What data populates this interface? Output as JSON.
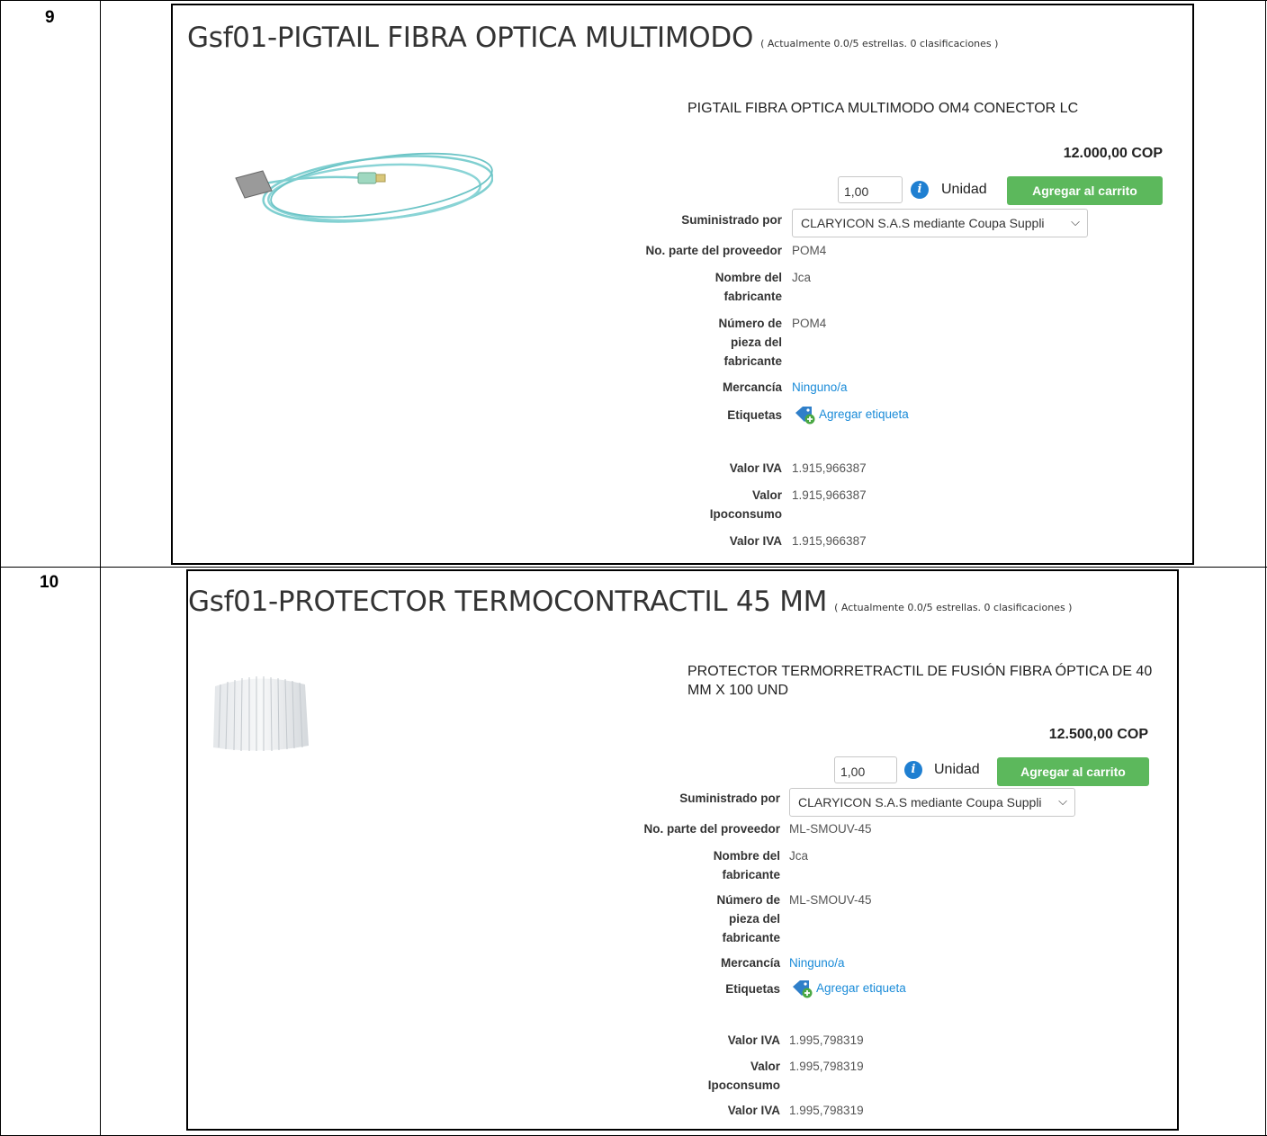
{
  "rows": [
    {
      "number": "9",
      "product": {
        "title": "Gsf01-PIGTAIL FIBRA OPTICA MULTIMODO",
        "rating": "( Actualmente 0.0/5 estrellas. 0 clasificaciones )",
        "description": "PIGTAIL FIBRA OPTICA MULTIMODO OM4 CONECTOR LC",
        "price": "12.000,00 COP",
        "quantity": "1,00",
        "unit": "Unidad",
        "cart_button": "Agregar al carrito",
        "supplier_label": "Suministrado por",
        "supplier_value": "CLARYICON S.A.S mediante Coupa Suppli",
        "supplier_part_label": "No. parte del proveedor",
        "supplier_part_value": "POM4",
        "manufacturer_label": "Nombre del fabricante",
        "manufacturer_value": "Jca",
        "manufacturer_part_label": "Número de pieza del fabricante",
        "manufacturer_part_value": "POM4",
        "commodity_label": "Mercancía",
        "commodity_value": "Ninguno/a",
        "tags_label": "Etiquetas",
        "tags_link": "Agregar etiqueta",
        "iva_label": "Valor IVA",
        "iva_value": "1.915,966387",
        "ipoconsumo_label": "Valor Ipoconsumo",
        "ipoconsumo_value": "1.915,966387",
        "iva2_label": "Valor IVA",
        "iva2_value": "1.915,966387"
      }
    },
    {
      "number": "10",
      "product": {
        "title": "Gsf01-PROTECTOR TERMOCONTRACTIL 45 MM",
        "rating": "( Actualmente 0.0/5 estrellas. 0 clasificaciones )",
        "description": "PROTECTOR TERMORRETRACTIL DE FUSIÓN FIBRA ÓPTICA DE 40 MM X 100 UND",
        "price": "12.500,00 COP",
        "quantity": "1,00",
        "unit": "Unidad",
        "cart_button": "Agregar al carrito",
        "supplier_label": "Suministrado por",
        "supplier_value": "CLARYICON S.A.S mediante Coupa Suppli",
        "supplier_part_label": "No. parte del proveedor",
        "supplier_part_value": "ML-SMOUV-45",
        "manufacturer_label": "Nombre del fabricante",
        "manufacturer_value": "Jca",
        "manufacturer_part_label": "Número de pieza del fabricante",
        "manufacturer_part_value": "ML-SMOUV-45",
        "commodity_label": "Mercancía",
        "commodity_value": "Ninguno/a",
        "tags_label": "Etiquetas",
        "tags_link": "Agregar etiqueta",
        "iva_label": "Valor IVA",
        "iva_value": "1.995,798319",
        "ipoconsumo_label": "Valor Ipoconsumo",
        "ipoconsumo_value": "1.995,798319",
        "iva2_label": "Valor IVA",
        "iva2_value": "1.995,798319"
      }
    }
  ]
}
